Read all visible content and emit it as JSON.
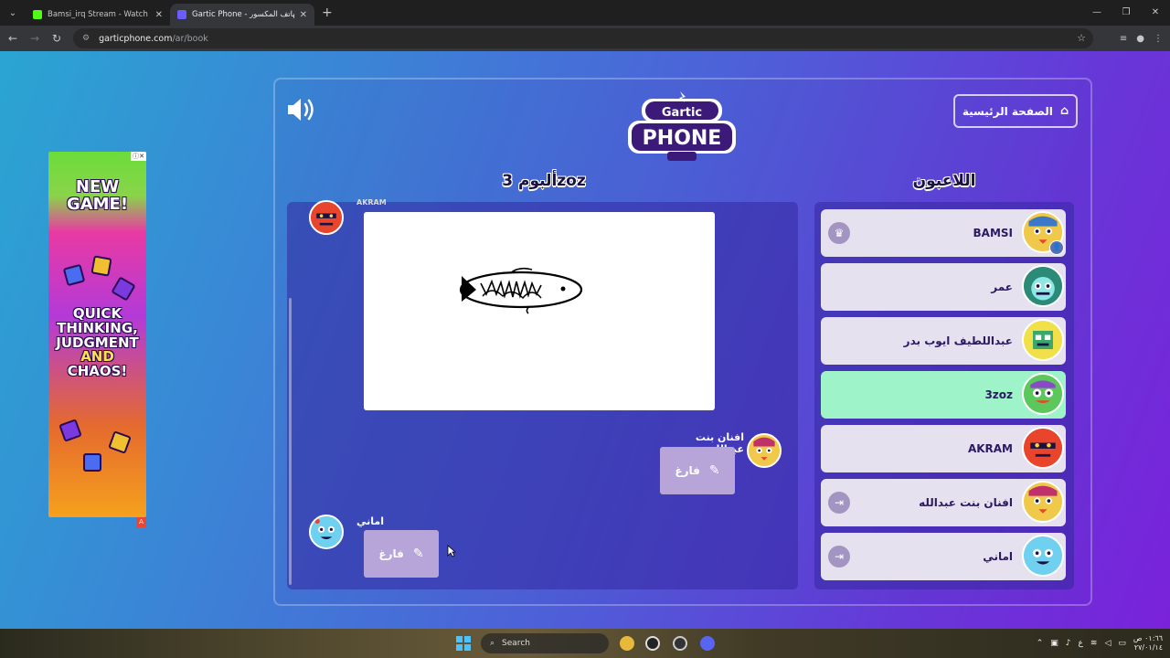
{
  "browser": {
    "tabs": [
      {
        "title": "Bamsi_irq Stream - Watch Live o",
        "favicon_color": "#53fc18",
        "active": false
      },
      {
        "title": "Gartic Phone - الهاتف المكسور",
        "favicon_color": "#6b5cff",
        "active": true
      }
    ],
    "url_host": "garticphone.com",
    "url_path": "/ar/book"
  },
  "ad": {
    "headline": "NEW GAME!",
    "body_line1": "QUICK THINKING,",
    "body_line2": "JUDGMENT",
    "body_line3": "AND",
    "body_line4": "CHAOS!"
  },
  "header": {
    "home_label": "الصفحة الرئيسية",
    "logo_top": "Gartic",
    "logo_main": "PHONE"
  },
  "album": {
    "title": "ألبوم 3zoz",
    "first_author": "AKRAM",
    "entries": [
      {
        "author": "افنان بنت عبدالله",
        "empty_label": "فارغ"
      },
      {
        "author": "اماني",
        "empty_label": "فارغ"
      }
    ]
  },
  "players": {
    "title": "اللاعبون",
    "list": [
      {
        "name": "BAMSI",
        "left_icon": "crown-icon",
        "host": true,
        "current": false
      },
      {
        "name": "عمر",
        "left_icon": "",
        "host": false,
        "current": false
      },
      {
        "name": "عبداللطيف ايوب بدر",
        "left_icon": "",
        "host": false,
        "current": false
      },
      {
        "name": "3zoz",
        "left_icon": "",
        "host": false,
        "current": true
      },
      {
        "name": "AKRAM",
        "left_icon": "",
        "host": false,
        "current": false
      },
      {
        "name": "افنان بنت عبدالله",
        "left_icon": "kick-icon",
        "host": false,
        "current": false
      },
      {
        "name": "اماني",
        "left_icon": "kick-icon",
        "host": false,
        "current": false
      }
    ]
  },
  "taskbar": {
    "search_label": "Search",
    "time": "٠١:٦٦ ص",
    "date": "٢٧/٠١/١٤",
    "lang": "ع"
  }
}
